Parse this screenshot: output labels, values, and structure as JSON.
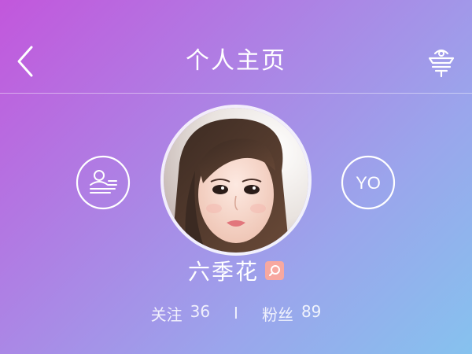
{
  "header": {
    "title": "个人主页",
    "back_icon": "chevron-left-icon",
    "right_icon": "beacon-icon"
  },
  "profile": {
    "name": "六季花",
    "badge_icon": "search-badge-icon",
    "left_icon": "profile-card-icon",
    "right_label": "YO",
    "stats": {
      "following_label": "关注",
      "following_value": "36",
      "separator": "I",
      "fans_label": "粉丝",
      "fans_value": "89"
    }
  },
  "colors": {
    "gradient_start": "#c257dc",
    "gradient_end": "#86c2ee",
    "badge": "#f7a8a0"
  }
}
